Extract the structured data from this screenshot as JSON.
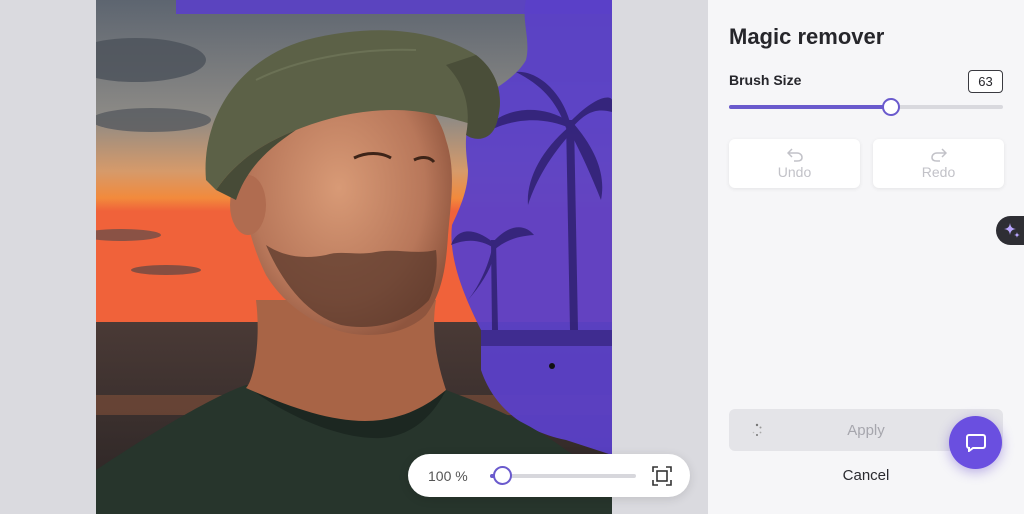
{
  "canvas": {
    "zoom_label": "100 %",
    "zoom_level": 0.05
  },
  "panel": {
    "title": "Magic remover",
    "brush": {
      "label": "Brush Size",
      "value": "63",
      "slider_fraction": 0.59
    },
    "undo_label": "Undo",
    "redo_label": "Redo",
    "apply_label": "Apply",
    "cancel_label": "Cancel"
  },
  "icons": {
    "undo": "undo-icon",
    "redo": "redo-icon",
    "fit": "fit-screen-icon",
    "ai": "sparkle-icon",
    "chat": "chat-bubble-icon",
    "spinner": "loading-spinner-icon"
  },
  "colors": {
    "accent": "#6a5acd",
    "mask": "#5b40c8",
    "chat": "#6a4fe0",
    "disabled_text": "#c2c2c8"
  }
}
